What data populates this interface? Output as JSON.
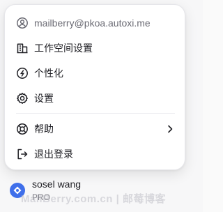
{
  "menu": {
    "account_email": "mailberry@pkoa.autoxi.me",
    "items": [
      {
        "label": "工作空间设置",
        "icon": "workspace-building-icon"
      },
      {
        "label": "个性化",
        "icon": "personalize-icon"
      },
      {
        "label": "设置",
        "icon": "gear-icon"
      }
    ],
    "help_label": "帮助",
    "logout_label": "退出登录"
  },
  "user": {
    "name": "sosel wang",
    "subtitle": "PRO"
  },
  "watermark": "MailBerry.com.cn | 邮莓博客",
  "colors": {
    "accent": "#3f6fea",
    "text": "#1f1f24",
    "muted": "#6b6b74"
  }
}
